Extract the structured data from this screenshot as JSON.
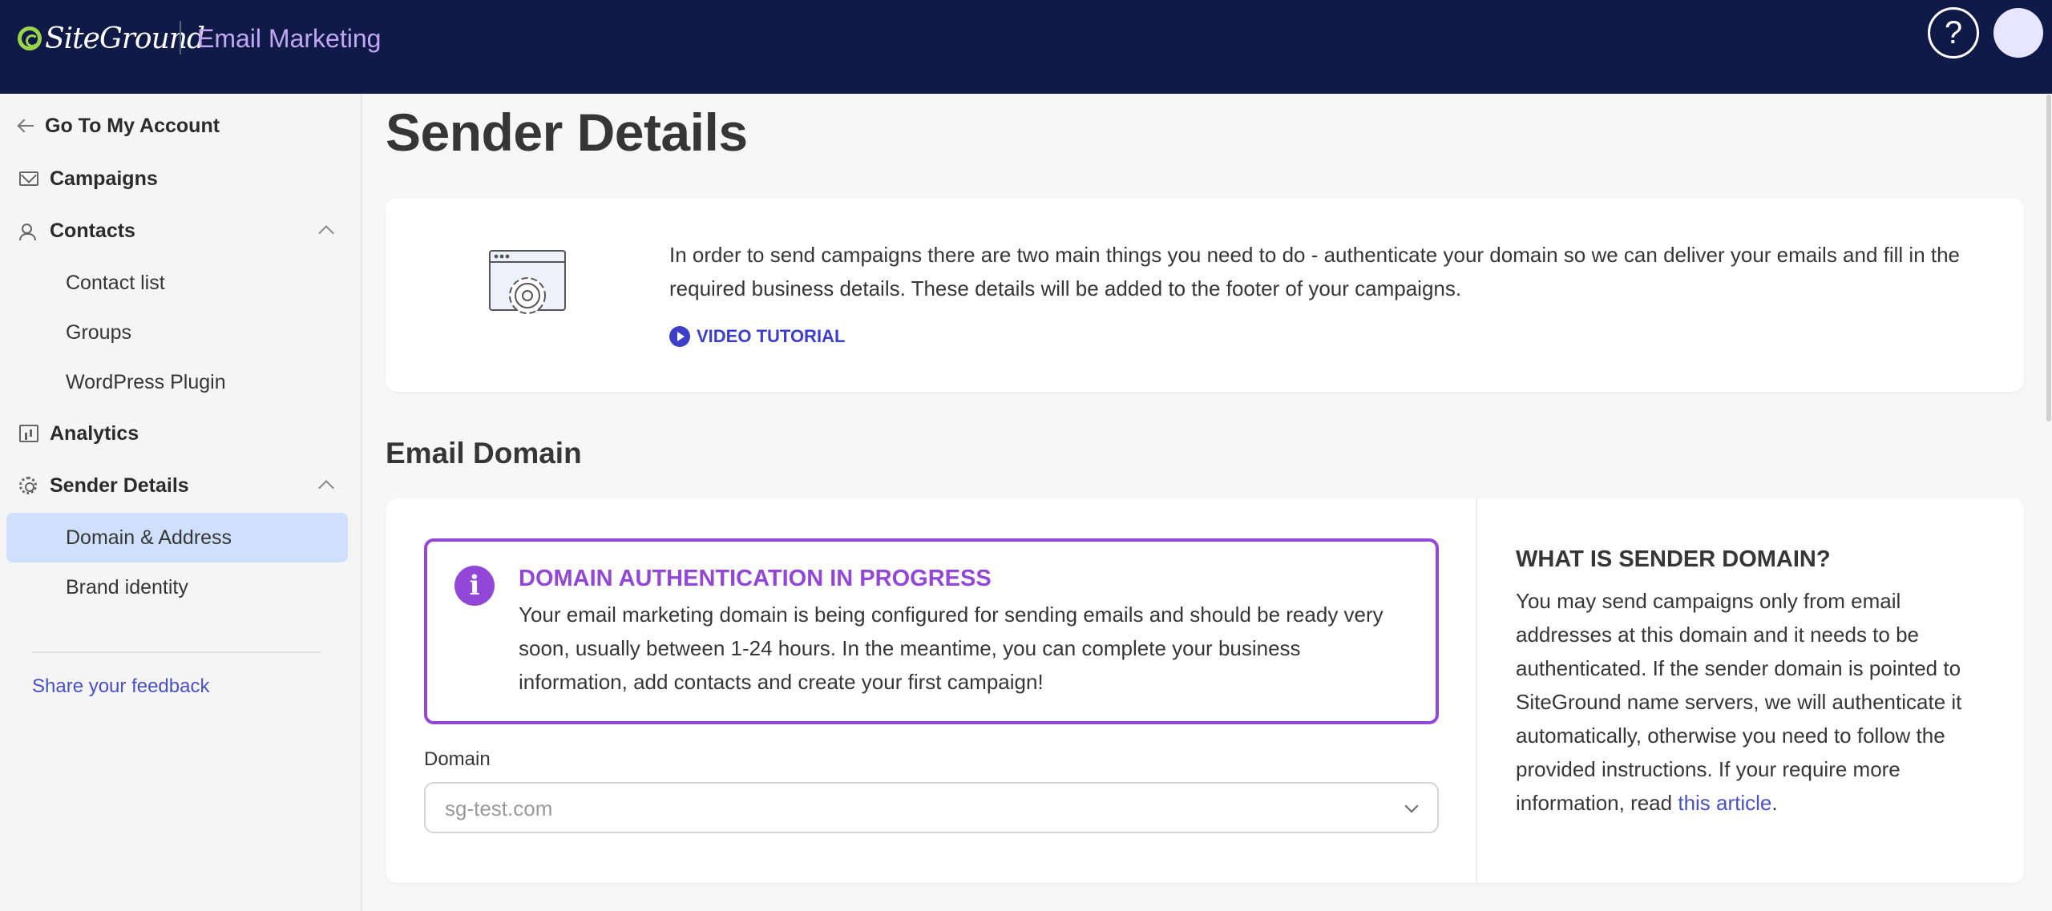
{
  "header": {
    "logo_text": "SiteGround",
    "app_name": "Email Marketing",
    "help_label": "?"
  },
  "sidebar": {
    "back_label": "Go To My Account",
    "items": [
      {
        "label": "Campaigns",
        "icon": "mail-icon"
      },
      {
        "label": "Contacts",
        "icon": "users-icon",
        "expanded": true,
        "children": [
          "Contact list",
          "Groups",
          "WordPress Plugin"
        ]
      },
      {
        "label": "Analytics",
        "icon": "chart-icon"
      },
      {
        "label": "Sender Details",
        "icon": "gear-icon",
        "expanded": true,
        "children": [
          "Domain & Address",
          "Brand identity"
        ]
      }
    ],
    "active_item": "Domain & Address",
    "feedback_label": "Share your feedback"
  },
  "main": {
    "title": "Sender Details",
    "intro": {
      "text": "In order to send campaigns there are two main things you need to do - authenticate your domain so we can deliver your emails and fill in the required business details. These details will be added to the footer of your campaigns.",
      "video_label": "VIDEO TUTORIAL"
    },
    "email_domain": {
      "section_title": "Email Domain",
      "notice_title": "DOMAIN AUTHENTICATION IN PROGRESS",
      "notice_text": "Your email marketing domain is being configured for sending emails and should be ready very soon, usually between 1-24 hours. In the meantime, you can complete your business information, add contacts and create your first campaign!",
      "domain_label": "Domain",
      "domain_value": "sg-test.com",
      "aside_title": "WHAT IS SENDER DOMAIN?",
      "aside_text": "You may send campaigns only from email addresses at this domain and it needs to be authenticated. If the sender domain is pointed to SiteGround name servers, we will authenticate it automatically, otherwise you need to follow the provided instructions. If your require more information, read",
      "aside_link": "this article",
      "aside_end": "."
    }
  },
  "colors": {
    "header_bg": "#0f1a47",
    "accent_purple": "#9247d6",
    "link_blue": "#4a4fc4",
    "active_bg": "#cfe0fc"
  }
}
